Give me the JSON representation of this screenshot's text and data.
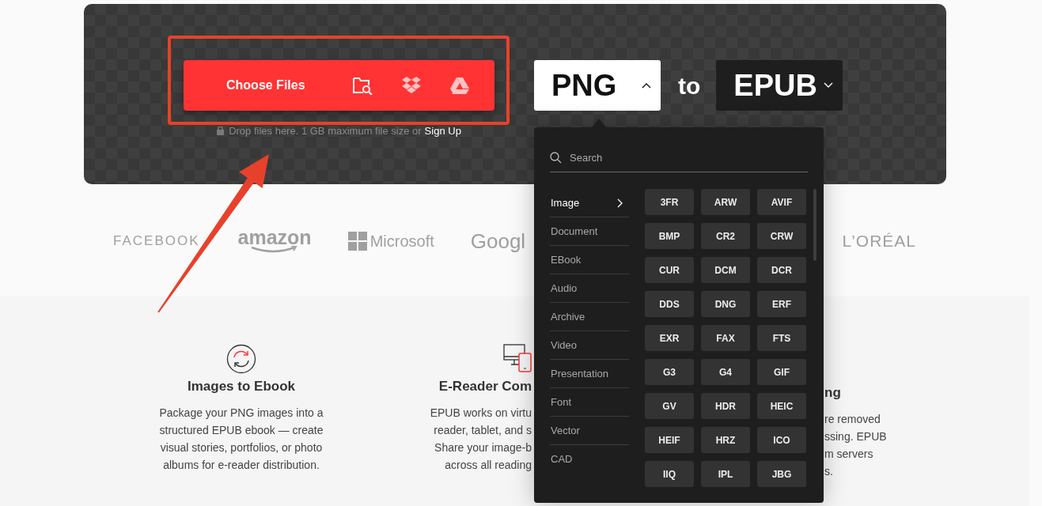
{
  "upload": {
    "button": "Choose Files",
    "note": "Drop files here. 1 GB maximum file size or",
    "link": "Sign Up"
  },
  "converter": {
    "from": {
      "label": "PNG",
      "expanded": true
    },
    "joiner": "to",
    "to": {
      "label": "EPUB",
      "expanded": false
    }
  },
  "dropdown": {
    "search": {
      "placeholder": "Search"
    },
    "categories": [
      {
        "label": "Image",
        "selected": true
      },
      {
        "label": "Document",
        "selected": false
      },
      {
        "label": "EBook",
        "selected": false
      },
      {
        "label": "Audio",
        "selected": false
      },
      {
        "label": "Archive",
        "selected": false
      },
      {
        "label": "Video",
        "selected": false
      },
      {
        "label": "Presentation",
        "selected": false
      },
      {
        "label": "Font",
        "selected": false
      },
      {
        "label": "Vector",
        "selected": false
      },
      {
        "label": "CAD",
        "selected": false
      }
    ],
    "formats": [
      "3FR",
      "ARW",
      "AVIF",
      "BMP",
      "CR2",
      "CRW",
      "CUR",
      "DCM",
      "DCR",
      "DDS",
      "DNG",
      "ERF",
      "EXR",
      "FAX",
      "FTS",
      "G3",
      "G4",
      "GIF",
      "GV",
      "HDR",
      "HEIC",
      "HEIF",
      "HRZ",
      "ICO",
      "IIQ",
      "IPL",
      "JBG"
    ]
  },
  "logos": [
    {
      "label": "FACEBOOK",
      "kind": "plain"
    },
    {
      "label": "amazon",
      "kind": "smile"
    },
    {
      "label": "Microsoft",
      "kind": "grid"
    },
    {
      "label": "Googl",
      "kind": "plain"
    },
    {
      "label": "L’ORÉAL",
      "kind": "plain"
    }
  ],
  "features": [
    {
      "title": "Images to Ebook",
      "lines": [
        "Package your PNG images into a",
        "structured EPUB ebook — create",
        "visual stories, portfolios, or photo",
        "albums for e-reader distribution."
      ]
    },
    {
      "title": "E-Reader Com",
      "lines": [
        "EPUB works on virtu",
        "reader, tablet, and s",
        "Share your image-b",
        "across all reading"
      ]
    },
    {
      "title": "ng",
      "lines": [
        "re removed",
        "ssing. EPUB",
        "m servers",
        "s."
      ]
    }
  ]
}
